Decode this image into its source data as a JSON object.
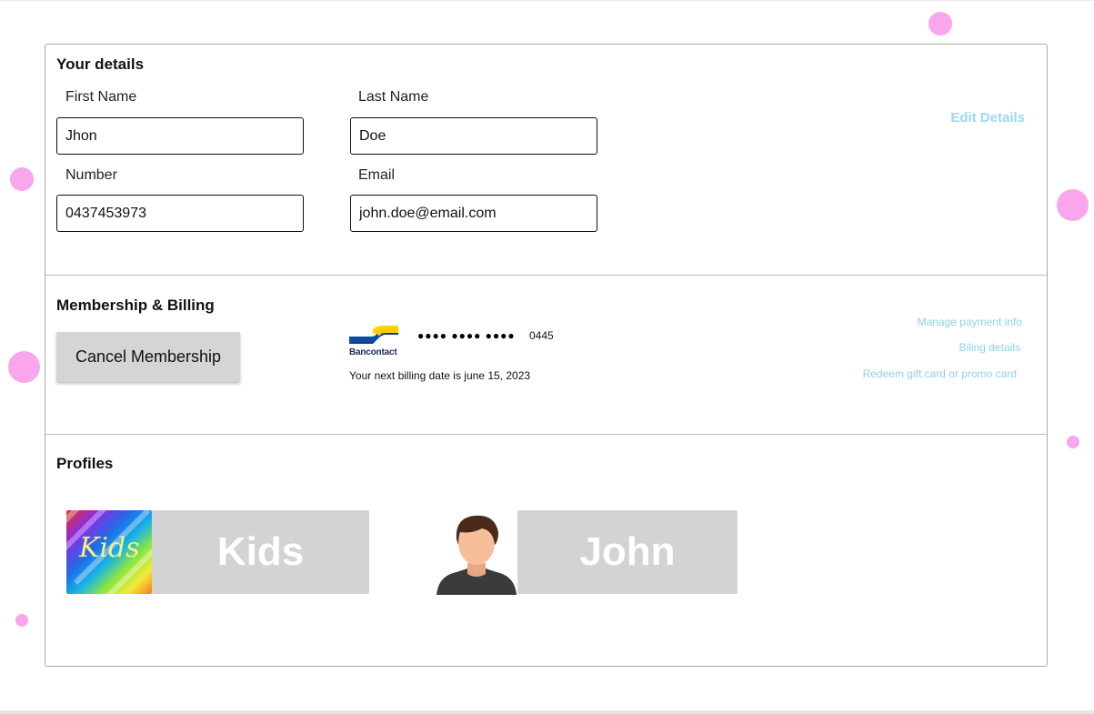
{
  "details": {
    "title": "Your details",
    "first_name_label": "First Name",
    "first_name_value": "Jhon",
    "last_name_label": "Last Name",
    "last_name_value": "Doe",
    "number_label": "Number",
    "number_value": "0437453973",
    "email_label": "Email",
    "email_value": "john.doe@email.com",
    "edit_link": "Edit Details"
  },
  "membership": {
    "title": "Membership & Billing",
    "cancel_button": "Cancel Membership",
    "card_brand": "Bancontact",
    "card_mask": "●●●● ●●●● ●●●●",
    "card_last4": "0445",
    "next_billing": "Your next billing date is june 15, 2023",
    "links": [
      "Manage payment info",
      "Biling details",
      "Redeem gift card or promo card"
    ]
  },
  "profiles": {
    "title": "Profiles",
    "items": [
      {
        "name": "Kids",
        "avatar_label": "Kids",
        "avatar_icon": "rainbow-kids-icon"
      },
      {
        "name": "John",
        "avatar_icon": "user-avatar-icon"
      }
    ]
  },
  "colors": {
    "link": "#8fd0ec",
    "decor_dot": "#f9a6ec",
    "button_bg": "#d5d5d5",
    "profile_bg": "#d3d3d3"
  }
}
